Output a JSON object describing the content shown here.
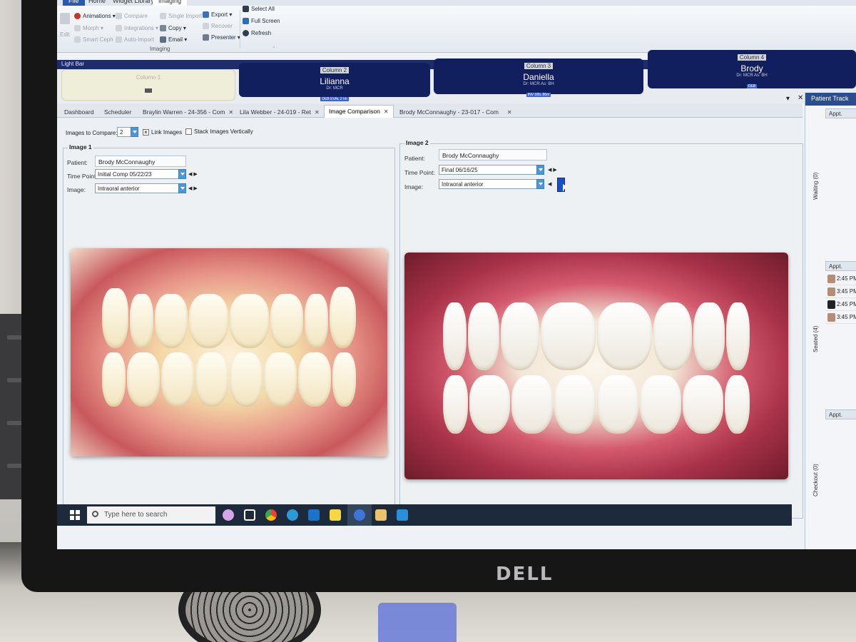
{
  "ribbon": {
    "tabs": [
      "File",
      "Home",
      "Widget Library",
      "Imaging"
    ],
    "buttons": {
      "edit": "Edit",
      "animations": "Animations",
      "compare": "Compare",
      "single_import": "Single Import",
      "export": "Export",
      "select_all": "Select All",
      "morph": "Morph",
      "integrations": "Integrations",
      "copy": "Copy",
      "recover": "Recover",
      "full_screen": "Full Screen",
      "smart_ceph": "Smart Ceph",
      "auto_import": "Auto-Import",
      "email": "Email",
      "presenter": "Presenter",
      "refresh": "Refresh"
    },
    "group_label": "Imaging"
  },
  "light_bar": {
    "title": "Light Bar",
    "columns": [
      {
        "label": "Column 1",
        "name": "",
        "sub": "",
        "badge": ""
      },
      {
        "label": "Column 2",
        "name": "Lilianna",
        "sub": "Dr: MCR",
        "badge": "DEB EVAL 2 hh"
      },
      {
        "label": "Column 3",
        "name": "Daniella",
        "sub": "Dr: MCR As: BH",
        "badge": "INV DBL 86m"
      },
      {
        "label": "Column 4",
        "name": "Brody",
        "sub": "Dr: MCR As: BH",
        "badge": "DEB"
      }
    ]
  },
  "doc_tabs": [
    {
      "label": "Dashboard"
    },
    {
      "label": "Scheduler"
    },
    {
      "label": "Braylin Warren - 24-356 - Com"
    },
    {
      "label": "Lila Webber - 24-019 - Ret"
    },
    {
      "label": "Image Comparison"
    },
    {
      "label": "Brody McConnaughy - 23-017 - Com"
    }
  ],
  "compare": {
    "images_label": "Images to Compare:",
    "images_value": "2",
    "link_images": "Link Images",
    "stack_vertically": "Stack Images Vertically"
  },
  "image1": {
    "legend": "Image 1",
    "patient_label": "Patient:",
    "patient": "Brody McConnaughy",
    "timepoint_label": "Time Point:",
    "timepoint": "Initial Comp  05/22/23",
    "image_label": "Image:",
    "image": "Intraoral anterior"
  },
  "image2": {
    "legend": "Image 2",
    "patient_label": "Patient:",
    "patient": "Brody McConnaughy",
    "timepoint_label": "Time Point:",
    "timepoint": "Final                06/16/25",
    "image_label": "Image:",
    "image": "Intraoral anterior"
  },
  "tracker": {
    "title": "Patient Track",
    "waiting": "Waiting (0)",
    "seated": "Seated (4)",
    "checkout": "Checkout (0)",
    "appt_header": "Appt.",
    "appts": [
      "2:45 PM",
      "3:45 PM",
      "2:45 PM",
      "3:45 PM"
    ]
  },
  "taskbar": {
    "search_placeholder": "Type here to search"
  },
  "monitor_brand": "DELL",
  "colors": {
    "light_bar": "#1d2d6b",
    "column_filled": "#121f5e",
    "accent": "#4d97d8",
    "taskbar": "#1c2a3c"
  }
}
